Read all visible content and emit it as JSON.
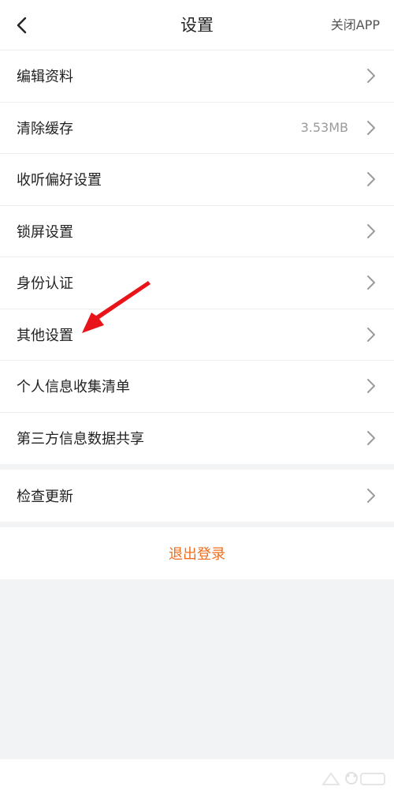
{
  "header": {
    "title": "设置",
    "close_label": "关闭APP",
    "back_icon": "chevron-left-icon"
  },
  "groups": [
    {
      "items": [
        {
          "label": "编辑资料",
          "value": ""
        },
        {
          "label": "清除缓存",
          "value": "3.53MB"
        },
        {
          "label": "收听偏好设置",
          "value": ""
        },
        {
          "label": "锁屏设置",
          "value": ""
        },
        {
          "label": "身份认证",
          "value": ""
        },
        {
          "label": "其他设置",
          "value": ""
        },
        {
          "label": "个人信息收集清单",
          "value": ""
        },
        {
          "label": "第三方信息数据共享",
          "value": ""
        }
      ]
    },
    {
      "items": [
        {
          "label": "检查更新",
          "value": ""
        }
      ]
    }
  ],
  "logout": {
    "label": "退出登录"
  },
  "colors": {
    "accent": "#ef6d1e",
    "annotation": "#e8141a",
    "background": "#f2f3f5"
  }
}
